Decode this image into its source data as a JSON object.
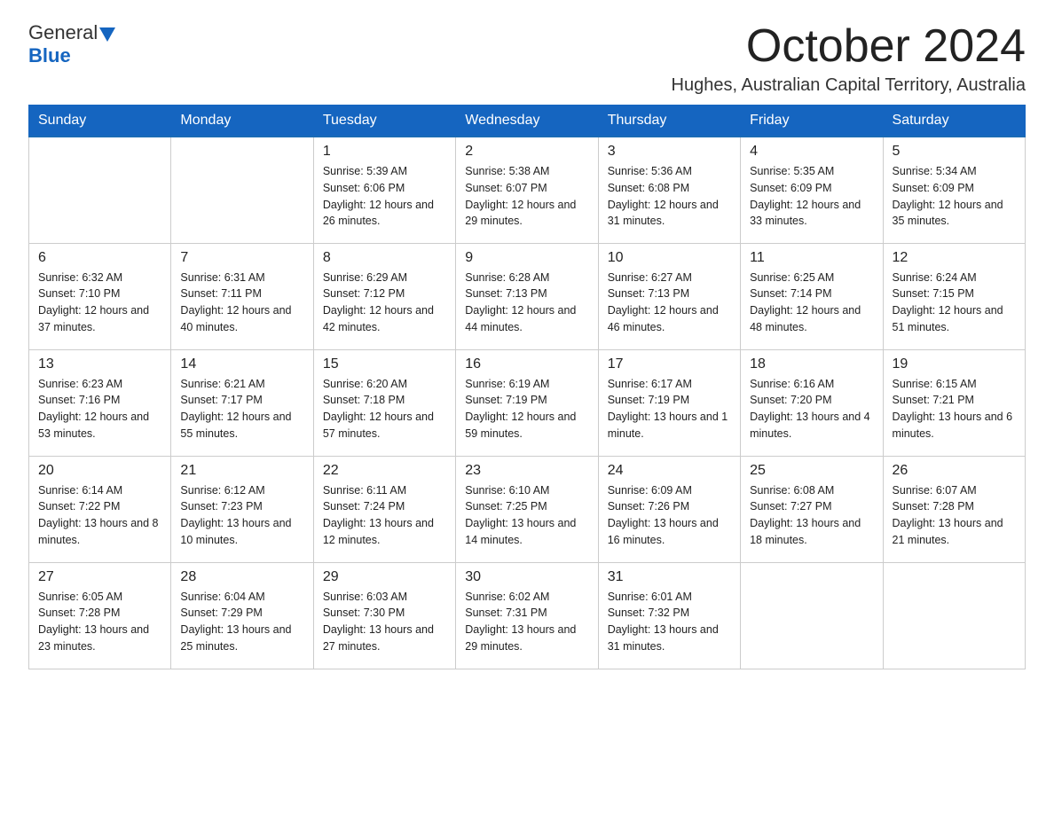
{
  "logo": {
    "general": "General",
    "blue": "Blue"
  },
  "title": "October 2024",
  "location": "Hughes, Australian Capital Territory, Australia",
  "days_of_week": [
    "Sunday",
    "Monday",
    "Tuesday",
    "Wednesday",
    "Thursday",
    "Friday",
    "Saturday"
  ],
  "weeks": [
    [
      {
        "day": "",
        "info": ""
      },
      {
        "day": "",
        "info": ""
      },
      {
        "day": "1",
        "info": "Sunrise: 5:39 AM\nSunset: 6:06 PM\nDaylight: 12 hours\nand 26 minutes."
      },
      {
        "day": "2",
        "info": "Sunrise: 5:38 AM\nSunset: 6:07 PM\nDaylight: 12 hours\nand 29 minutes."
      },
      {
        "day": "3",
        "info": "Sunrise: 5:36 AM\nSunset: 6:08 PM\nDaylight: 12 hours\nand 31 minutes."
      },
      {
        "day": "4",
        "info": "Sunrise: 5:35 AM\nSunset: 6:09 PM\nDaylight: 12 hours\nand 33 minutes."
      },
      {
        "day": "5",
        "info": "Sunrise: 5:34 AM\nSunset: 6:09 PM\nDaylight: 12 hours\nand 35 minutes."
      }
    ],
    [
      {
        "day": "6",
        "info": "Sunrise: 6:32 AM\nSunset: 7:10 PM\nDaylight: 12 hours\nand 37 minutes."
      },
      {
        "day": "7",
        "info": "Sunrise: 6:31 AM\nSunset: 7:11 PM\nDaylight: 12 hours\nand 40 minutes."
      },
      {
        "day": "8",
        "info": "Sunrise: 6:29 AM\nSunset: 7:12 PM\nDaylight: 12 hours\nand 42 minutes."
      },
      {
        "day": "9",
        "info": "Sunrise: 6:28 AM\nSunset: 7:13 PM\nDaylight: 12 hours\nand 44 minutes."
      },
      {
        "day": "10",
        "info": "Sunrise: 6:27 AM\nSunset: 7:13 PM\nDaylight: 12 hours\nand 46 minutes."
      },
      {
        "day": "11",
        "info": "Sunrise: 6:25 AM\nSunset: 7:14 PM\nDaylight: 12 hours\nand 48 minutes."
      },
      {
        "day": "12",
        "info": "Sunrise: 6:24 AM\nSunset: 7:15 PM\nDaylight: 12 hours\nand 51 minutes."
      }
    ],
    [
      {
        "day": "13",
        "info": "Sunrise: 6:23 AM\nSunset: 7:16 PM\nDaylight: 12 hours\nand 53 minutes."
      },
      {
        "day": "14",
        "info": "Sunrise: 6:21 AM\nSunset: 7:17 PM\nDaylight: 12 hours\nand 55 minutes."
      },
      {
        "day": "15",
        "info": "Sunrise: 6:20 AM\nSunset: 7:18 PM\nDaylight: 12 hours\nand 57 minutes."
      },
      {
        "day": "16",
        "info": "Sunrise: 6:19 AM\nSunset: 7:19 PM\nDaylight: 12 hours\nand 59 minutes."
      },
      {
        "day": "17",
        "info": "Sunrise: 6:17 AM\nSunset: 7:19 PM\nDaylight: 13 hours\nand 1 minute."
      },
      {
        "day": "18",
        "info": "Sunrise: 6:16 AM\nSunset: 7:20 PM\nDaylight: 13 hours\nand 4 minutes."
      },
      {
        "day": "19",
        "info": "Sunrise: 6:15 AM\nSunset: 7:21 PM\nDaylight: 13 hours\nand 6 minutes."
      }
    ],
    [
      {
        "day": "20",
        "info": "Sunrise: 6:14 AM\nSunset: 7:22 PM\nDaylight: 13 hours\nand 8 minutes."
      },
      {
        "day": "21",
        "info": "Sunrise: 6:12 AM\nSunset: 7:23 PM\nDaylight: 13 hours\nand 10 minutes."
      },
      {
        "day": "22",
        "info": "Sunrise: 6:11 AM\nSunset: 7:24 PM\nDaylight: 13 hours\nand 12 minutes."
      },
      {
        "day": "23",
        "info": "Sunrise: 6:10 AM\nSunset: 7:25 PM\nDaylight: 13 hours\nand 14 minutes."
      },
      {
        "day": "24",
        "info": "Sunrise: 6:09 AM\nSunset: 7:26 PM\nDaylight: 13 hours\nand 16 minutes."
      },
      {
        "day": "25",
        "info": "Sunrise: 6:08 AM\nSunset: 7:27 PM\nDaylight: 13 hours\nand 18 minutes."
      },
      {
        "day": "26",
        "info": "Sunrise: 6:07 AM\nSunset: 7:28 PM\nDaylight: 13 hours\nand 21 minutes."
      }
    ],
    [
      {
        "day": "27",
        "info": "Sunrise: 6:05 AM\nSunset: 7:28 PM\nDaylight: 13 hours\nand 23 minutes."
      },
      {
        "day": "28",
        "info": "Sunrise: 6:04 AM\nSunset: 7:29 PM\nDaylight: 13 hours\nand 25 minutes."
      },
      {
        "day": "29",
        "info": "Sunrise: 6:03 AM\nSunset: 7:30 PM\nDaylight: 13 hours\nand 27 minutes."
      },
      {
        "day": "30",
        "info": "Sunrise: 6:02 AM\nSunset: 7:31 PM\nDaylight: 13 hours\nand 29 minutes."
      },
      {
        "day": "31",
        "info": "Sunrise: 6:01 AM\nSunset: 7:32 PM\nDaylight: 13 hours\nand 31 minutes."
      },
      {
        "day": "",
        "info": ""
      },
      {
        "day": "",
        "info": ""
      }
    ]
  ]
}
